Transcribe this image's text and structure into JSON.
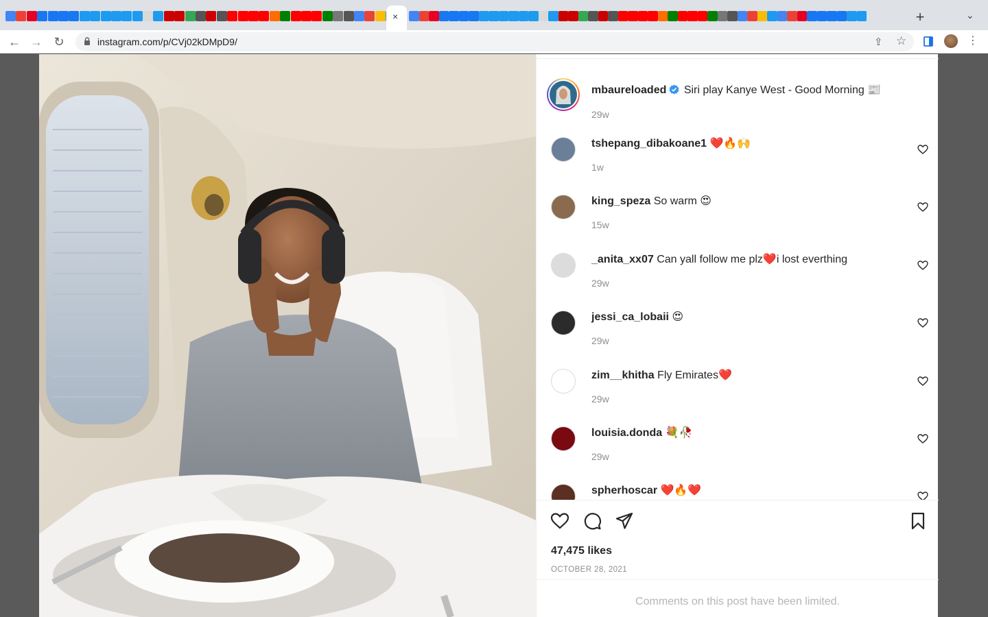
{
  "browser": {
    "tab_icon_colors": [
      "#4285f4",
      "#ea4335",
      "#e60023",
      "#1877f2",
      "#1877f2",
      "#1877f2",
      "#1877f2",
      "#1d9bf0",
      "#1d9bf0",
      "#1d9bf0",
      "#1d9bf0",
      "#1d9bf0",
      "#1d9bf0",
      "#d9d9d9",
      "#1d9bf0",
      "#cc0000",
      "#cc0000",
      "#34a853",
      "#555555",
      "#cc0000",
      "#555555",
      "#ff0000",
      "#ff0000",
      "#ff0000",
      "#ff0000",
      "#ff6d00",
      "#008000",
      "#ff0000",
      "#ff0000",
      "#ff0000",
      "#008000",
      "#777777",
      "#555555",
      "#4285f4",
      "#ea4335",
      "#fbbc05",
      "#1d9bf0"
    ],
    "active_tab_close": "×",
    "url": "instagram.com/p/CVj02kDMpD9/",
    "back_label": "←",
    "forward_label": "→",
    "reload_label": "↻",
    "new_tab_label": "+",
    "tab_search_label": "⌄",
    "share_label": "⇪",
    "bookmark_label": "☆",
    "menu_label": "⋮"
  },
  "post": {
    "author": "mbaureloaded",
    "caption": "Siri play Kanye West - Good Morning 📰",
    "caption_time": "29w",
    "likes": "47,475 likes",
    "date": "OCTOBER 28, 2021",
    "comments_limited": "Comments on this post have been limited.",
    "comments": [
      {
        "user": "tshepang_dibakoane1",
        "text": "❤️🔥🙌",
        "time": "1w",
        "avatar_color": "#6b7f99"
      },
      {
        "user": "king_speza",
        "text": "So warm 😍",
        "time": "15w",
        "avatar_color": "#8a6b4f"
      },
      {
        "user": "_anita_xx07",
        "text": "Can yall follow me plz❤️i lost everthing",
        "time": "29w",
        "avatar_color": "#dcdcdc"
      },
      {
        "user": "jessi_ca_lobaii",
        "text": "😍",
        "time": "29w",
        "avatar_color": "#2b2b2b"
      },
      {
        "user": "zim__khitha",
        "text": "Fly Emirates❤️",
        "time": "29w",
        "avatar_color": "#ffffff"
      },
      {
        "user": "louisia.donda",
        "text": "💐🥀",
        "time": "29w",
        "avatar_color": "#7a0a12"
      },
      {
        "user": "spherhoscar",
        "text": "❤️🔥❤️",
        "time": "",
        "avatar_color": "#5b2f22"
      }
    ]
  }
}
